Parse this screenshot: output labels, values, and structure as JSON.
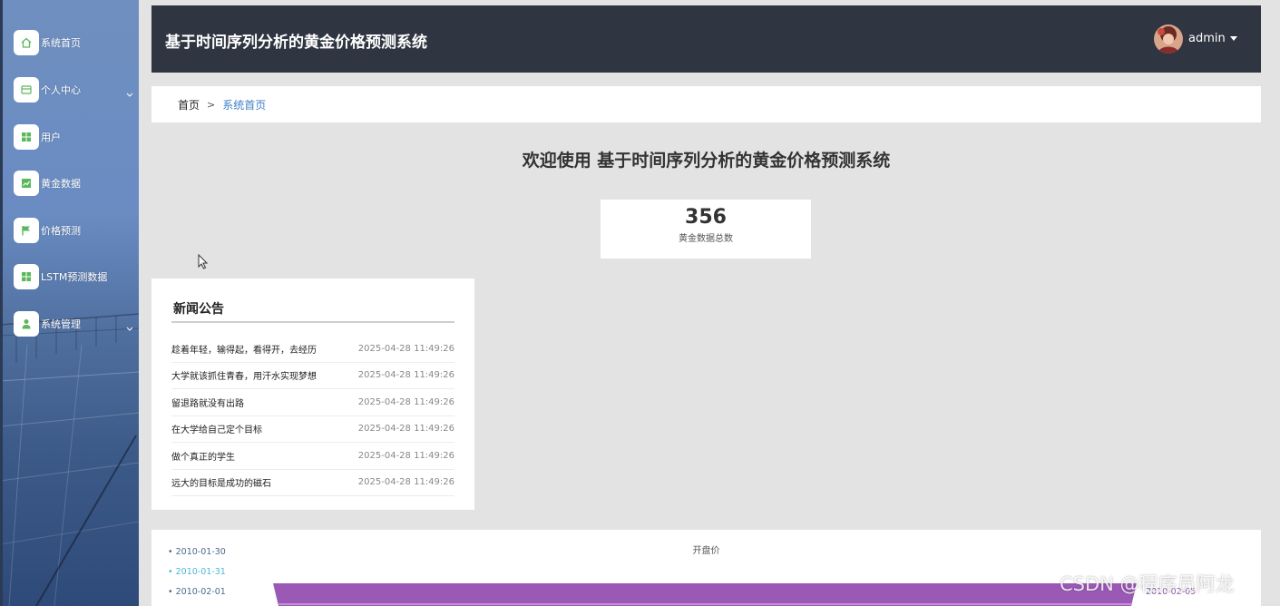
{
  "sidebar": {
    "items": [
      {
        "label": "系统首页",
        "icon": "home-icon"
      },
      {
        "label": "个人中心",
        "icon": "card-icon",
        "expandable": true
      },
      {
        "label": "用户",
        "icon": "grid-icon"
      },
      {
        "label": "黄金数据",
        "icon": "chart-icon"
      },
      {
        "label": "价格预测",
        "icon": "flag-icon"
      },
      {
        "label": "LSTM预测数据",
        "icon": "grid-icon"
      },
      {
        "label": "系统管理",
        "icon": "person-icon",
        "expandable": true
      }
    ],
    "icon_color": "#5cb85c"
  },
  "header": {
    "title": "基于时间序列分析的黄金价格预测系统",
    "username": "admin"
  },
  "breadcrumb": {
    "home": "首页",
    "separator": ">",
    "current": "系统首页"
  },
  "welcome": "欢迎使用 基于时间序列分析的黄金价格预测系统",
  "stat": {
    "value": "356",
    "caption": "黄金数据总数"
  },
  "news": {
    "title": "新闻公告",
    "items": [
      {
        "title": "趁着年轻，输得起，看得开，去经历",
        "date": "2025-04-28 11:49:26"
      },
      {
        "title": "大学就该抓住青春，用汗水实现梦想",
        "date": "2025-04-28 11:49:26"
      },
      {
        "title": "留退路就没有出路",
        "date": "2025-04-28 11:49:26"
      },
      {
        "title": "在大学给自己定个目标",
        "date": "2025-04-28 11:49:26"
      },
      {
        "title": "做个真正的学生",
        "date": "2025-04-28 11:49:26"
      },
      {
        "title": "远大的目标是成功的磁石",
        "date": "2025-04-28 11:49:26"
      }
    ]
  },
  "chart_data": {
    "type": "area",
    "title": "开盘价",
    "legend": [
      {
        "label": "2010-01-30",
        "color": "#4a6a8f"
      },
      {
        "label": "2010-01-31",
        "color": "#4fb8cf"
      },
      {
        "label": "2010-02-01",
        "color": "#4a6a8f"
      }
    ],
    "legend_position": "left",
    "right_label": "2010-02-05",
    "fill_color": "#9b59b6"
  },
  "watermark": "CSDN @程序员阿龙"
}
